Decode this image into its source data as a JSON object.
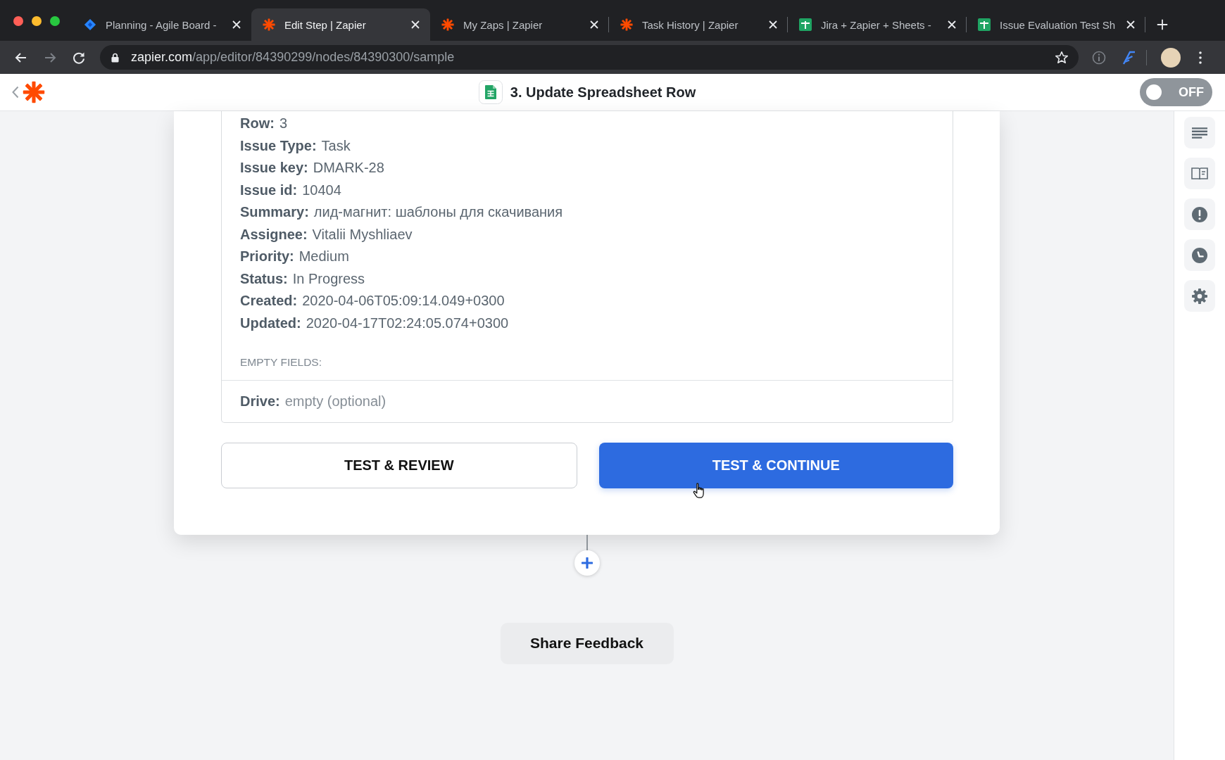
{
  "browser": {
    "tabs": [
      {
        "title": "Planning - Agile Board -",
        "kind": "diamond",
        "selected": false
      },
      {
        "title": "Edit Step | Zapier",
        "kind": "asterisk",
        "selected": true
      },
      {
        "title": "My Zaps | Zapier",
        "kind": "asterisk",
        "selected": false
      },
      {
        "title": "Task History | Zapier",
        "kind": "asterisk",
        "selected": false
      },
      {
        "title": "Jira + Zapier + Sheets -",
        "kind": "sheet",
        "selected": false
      },
      {
        "title": "Issue Evaluation Test Sh",
        "kind": "sheet",
        "selected": false
      }
    ],
    "nav": [
      {
        "kind": "back",
        "disabled": false
      },
      {
        "kind": "forward",
        "disabled": true
      },
      {
        "kind": "reload",
        "disabled": false
      }
    ],
    "url": {
      "host": "zapier.com",
      "path": "/app/editor/84390299/nodes/84390300/sample"
    }
  },
  "header": {
    "title": "3. Update Spreadsheet Row",
    "toggle": {
      "label": "OFF",
      "on": false
    }
  },
  "sample": {
    "fields": [
      {
        "label": "Row:",
        "value": "3"
      },
      {
        "label": "Issue Type:",
        "value": "Task"
      },
      {
        "label": "Issue key:",
        "value": "DMARK-28"
      },
      {
        "label": "Issue id:",
        "value": "10404"
      },
      {
        "label": "Summary:",
        "value": "лид-магнит: шаблоны для скачивания"
      },
      {
        "label": "Assignee:",
        "value": "Vitalii Myshliaev"
      },
      {
        "label": "Priority:",
        "value": "Medium"
      },
      {
        "label": "Status:",
        "value": "In Progress"
      },
      {
        "label": "Created:",
        "value": "2020-04-06T05:09:14.049+0300"
      },
      {
        "label": "Updated:",
        "value": "2020-04-17T02:24:05.074+0300"
      }
    ],
    "empty_heading": "EMPTY FIELDS:",
    "empty_fields": [
      {
        "label": "Drive:",
        "value": "empty (optional)"
      }
    ]
  },
  "buttons": [
    {
      "label": "TEST & REVIEW",
      "kind": "secondary"
    },
    {
      "label": "TEST & CONTINUE",
      "kind": "primary"
    }
  ],
  "feedback_button": {
    "label": "Share Feedback"
  }
}
